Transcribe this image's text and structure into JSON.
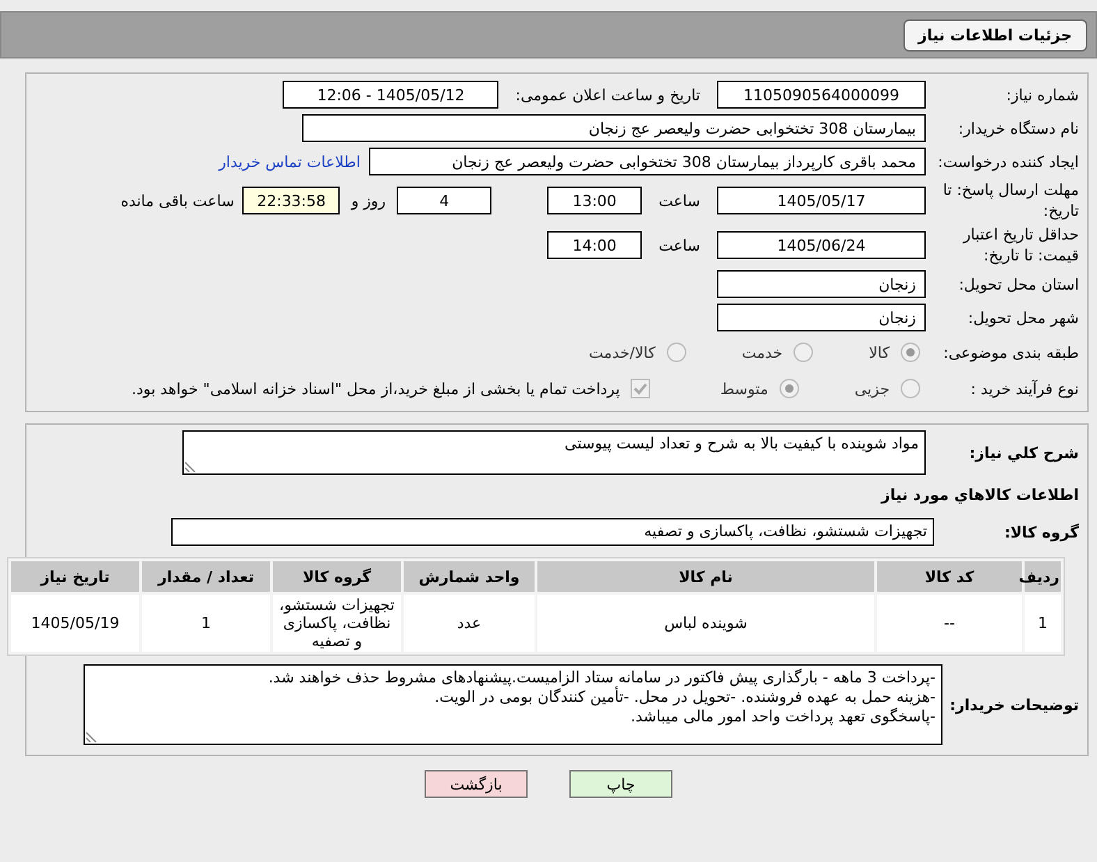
{
  "header": {
    "title": "جزئیات اطلاعات نیاز"
  },
  "need_number": {
    "label": "شماره نیاز:",
    "value": "1105090564000099"
  },
  "announce": {
    "label": "تاریخ و ساعت اعلان عمومی:",
    "value": "1405/05/12 - 12:06"
  },
  "buyer_org": {
    "label": "نام دستگاه خریدار:",
    "value": "بیمارستان 308 تختخوابی حضرت ولیعصر عج  زنجان"
  },
  "requester": {
    "label": "ایجاد کننده درخواست:",
    "value": "محمد باقری کارپرداز بیمارستان 308 تختخوابی حضرت ولیعصر عج  زنجان",
    "link": "اطلاعات تماس خریدار"
  },
  "deadline": {
    "label": "مهلت ارسال پاسخ: تا تاریخ:",
    "date": "1405/05/17",
    "time_label": "ساعت",
    "time": "13:00",
    "days": "4",
    "days_label": "روز و",
    "remaining": "22:33:58",
    "remaining_label": "ساعت باقی مانده"
  },
  "validity": {
    "label": "حداقل تاریخ اعتبار قیمت: تا تاریخ:",
    "date": "1405/06/24",
    "time_label": "ساعت",
    "time": "14:00"
  },
  "province": {
    "label": "استان محل تحویل:",
    "value": "زنجان"
  },
  "city": {
    "label": "شهر محل تحویل:",
    "value": "زنجان"
  },
  "category": {
    "label": "طبقه بندی موضوعی:",
    "options": [
      {
        "label": "کالا",
        "selected": true
      },
      {
        "label": "خدمت",
        "selected": false
      },
      {
        "label": "کالا/خدمت",
        "selected": false
      }
    ]
  },
  "process": {
    "label": "نوع فرآیند خرید :",
    "options": [
      {
        "label": "جزیی",
        "selected": false
      },
      {
        "label": "متوسط",
        "selected": true
      }
    ],
    "treasury": {
      "checked": true,
      "label": "پرداخت تمام یا بخشی از مبلغ خرید،از محل \"اسناد خزانه اسلامی\" خواهد بود."
    }
  },
  "description": {
    "label": "شرح کلي نياز:",
    "value": "مواد شوینده با کیفیت بالا به شرح و تعداد لیست پیوستی"
  },
  "goods_title": "اطلاعات کالاهاي مورد نياز",
  "goods_group": {
    "label": "گروه کالا:",
    "value": "تجهیزات شستشو، نظافت، پاکسازی و تصفیه"
  },
  "table": {
    "columns": [
      "ردیف",
      "کد کالا",
      "نام کالا",
      "واحد شمارش",
      "گروه کالا",
      "تعداد / مقدار",
      "تاریخ نیاز"
    ],
    "rows": [
      [
        "1",
        "--",
        "شوینده لباس",
        "عدد",
        "تجهیزات شستشو، نظافت، پاکسازی و تصفیه",
        "1",
        "1405/05/19"
      ]
    ]
  },
  "buyer_notes": {
    "label": "توضیحات خریدار:",
    "lines": [
      "-پرداخت  3 ماهه - بارگذاری پیش فاکتور در سامانه ستاد الزامیست.پیشنهادهای مشروط حذف خواهند شد.",
      "-هزینه حمل به عهده فروشنده. -تحویل در محل. -تأمین کنندگان بومی در الویت.",
      "-پاسخگوی تعهد پرداخت واحد امور مالی میباشد."
    ]
  },
  "buttons": [
    {
      "label": "چاپ",
      "kind": "print"
    },
    {
      "label": "بازگشت",
      "kind": "back"
    }
  ]
}
